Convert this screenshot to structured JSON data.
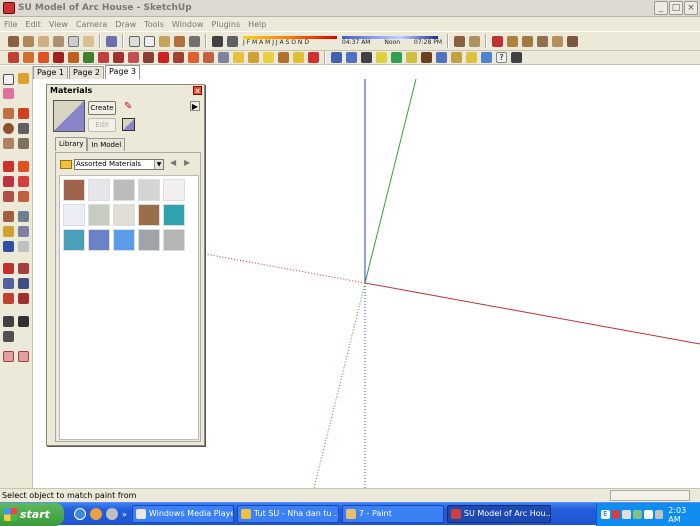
{
  "window": {
    "title": "SU Model of Arc House - SketchUp",
    "controls": [
      "minimize",
      "maximize",
      "close"
    ]
  },
  "menubar": [
    "File",
    "Edit",
    "View",
    "Camera",
    "Draw",
    "Tools",
    "Window",
    "Plugins",
    "Help"
  ],
  "shadow_toolbar": {
    "months": "J F M A M J J A S O N D",
    "time_start": "04:37 AM",
    "time_mid": "Noon",
    "time_end": "07:28 PM"
  },
  "scene_tabs": [
    "Page 1",
    "Page 2",
    "Page 3"
  ],
  "active_scene_tab": "Page 3",
  "materials_panel": {
    "title": "Materials",
    "create_label": "Create",
    "edit_label": "Edit",
    "tabs": [
      "Library",
      "In Model"
    ],
    "active_tab": "Library",
    "library_selected": "Assorted Materials",
    "swatches": [
      {
        "name": "brown-tile",
        "color": "#a0644e"
      },
      {
        "name": "light-grey-fabric",
        "color": "#e6e6ea"
      },
      {
        "name": "grey-stone",
        "color": "#bcbcbc"
      },
      {
        "name": "grey-tile-grid",
        "color": "#d4d4d4"
      },
      {
        "name": "off-white",
        "color": "#f2efee"
      },
      {
        "name": "pale-blue-white",
        "color": "#eceef6"
      },
      {
        "name": "sage-marble",
        "color": "#c4cdc0"
      },
      {
        "name": "beige-marble",
        "color": "#e0dcd6"
      },
      {
        "name": "brown-wood",
        "color": "#9a6e4a"
      },
      {
        "name": "teal-water",
        "color": "#2fa2b0"
      },
      {
        "name": "teal-blend",
        "color": "#4aa0b8"
      },
      {
        "name": "blue-cloud",
        "color": "#6c82c8"
      },
      {
        "name": "sky-blue",
        "color": "#5a9ce8"
      },
      {
        "name": "grey-granite",
        "color": "#a0a4a8"
      },
      {
        "name": "grey-concrete",
        "color": "#b4b6b8"
      }
    ]
  },
  "status_text": "Select object to match paint from",
  "taskbar": {
    "start_label": "start",
    "tasks": [
      {
        "label": "Windows Media Player",
        "color": "#e8e8e8",
        "active": false
      },
      {
        "label": "Tut SU - Nha dan tu ...",
        "color": "#f0c040",
        "active": false
      },
      {
        "label": "7 - Paint",
        "color": "#e8c070",
        "active": false
      },
      {
        "label": "SU Model of Arc Hou...",
        "color": "#d04040",
        "active": true
      }
    ],
    "clock": "2:03 AM"
  },
  "colors": {
    "axis_red": "#c43030",
    "axis_green": "#30a030",
    "axis_blue": "#2040c0",
    "taskbar_blue": "#245edb",
    "start_green": "#3a9a3a"
  }
}
